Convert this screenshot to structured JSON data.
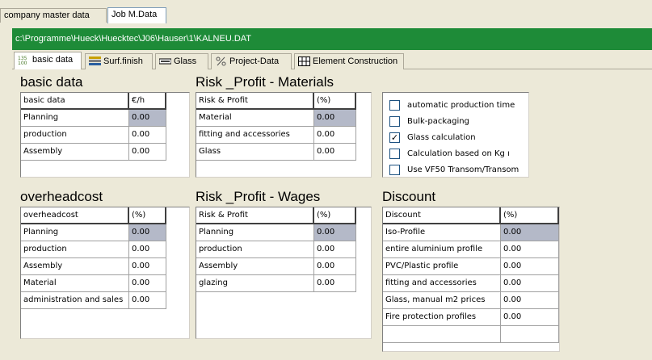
{
  "window_tabs": [
    "company master data",
    "Job M.Data"
  ],
  "path": "c:\\Programme\\Hueck\\Huecktec\\J06\\Hauser\\1\\KALNEU.DAT",
  "subtabs": {
    "basic_data": "basic data",
    "surf_finish": "Surf.finish",
    "glass": "Glass",
    "project_data": "Project-Data",
    "element_construction": "Element Construction"
  },
  "basic_data": {
    "title": "basic data",
    "header": [
      "basic data",
      "€/h"
    ],
    "rows": [
      [
        "Planning",
        "0.00"
      ],
      [
        "production",
        "0.00"
      ],
      [
        "Assembly",
        "0.00"
      ]
    ]
  },
  "risk_materials": {
    "title": "Risk _Profit - Materials",
    "header": [
      "Risk & Profit",
      "(%)"
    ],
    "rows": [
      [
        "Material",
        "0.00"
      ],
      [
        "fitting and accessories",
        "0.00"
      ],
      [
        "Glass",
        "0.00"
      ]
    ]
  },
  "options": [
    {
      "label": "automatic production time",
      "checked": false
    },
    {
      "label": "Bulk-packaging",
      "checked": false
    },
    {
      "label": "Glass calculation",
      "checked": true
    },
    {
      "label": "Calculation based on Kg ı",
      "checked": false
    },
    {
      "label": "Use VF50 Transom/Transom",
      "checked": false
    }
  ],
  "overheadcost": {
    "title": "overheadcost",
    "header": [
      "overheadcost",
      "(%)"
    ],
    "rows": [
      [
        "Planning",
        "0.00"
      ],
      [
        "production",
        "0.00"
      ],
      [
        "Assembly",
        "0.00"
      ],
      [
        "Material",
        "0.00"
      ],
      [
        "administration and sales",
        "0.00"
      ]
    ]
  },
  "risk_wages": {
    "title": "Risk _Profit - Wages",
    "header": [
      "Risk & Profit",
      "(%)"
    ],
    "rows": [
      [
        "Planning",
        "0.00"
      ],
      [
        "production",
        "0.00"
      ],
      [
        "Assembly",
        "0.00"
      ],
      [
        "glazing",
        "0.00"
      ]
    ]
  },
  "discount": {
    "title": "Discount",
    "header": [
      "Discount",
      "(%)"
    ],
    "rows": [
      [
        "Iso-Profile",
        "0.00"
      ],
      [
        "entire aluminium profile",
        "0.00"
      ],
      [
        "PVC/Plastic profile",
        "0.00"
      ],
      [
        "fitting and accessories",
        "0.00"
      ],
      [
        "Glass, manual m2 prices",
        "0.00"
      ],
      [
        "Fire protection profiles",
        "0.00"
      ]
    ]
  },
  "colors": {
    "path_bar": "#1e8b38",
    "selected_cell": "#b4b9c8",
    "window_bg": "#ece9d8"
  }
}
